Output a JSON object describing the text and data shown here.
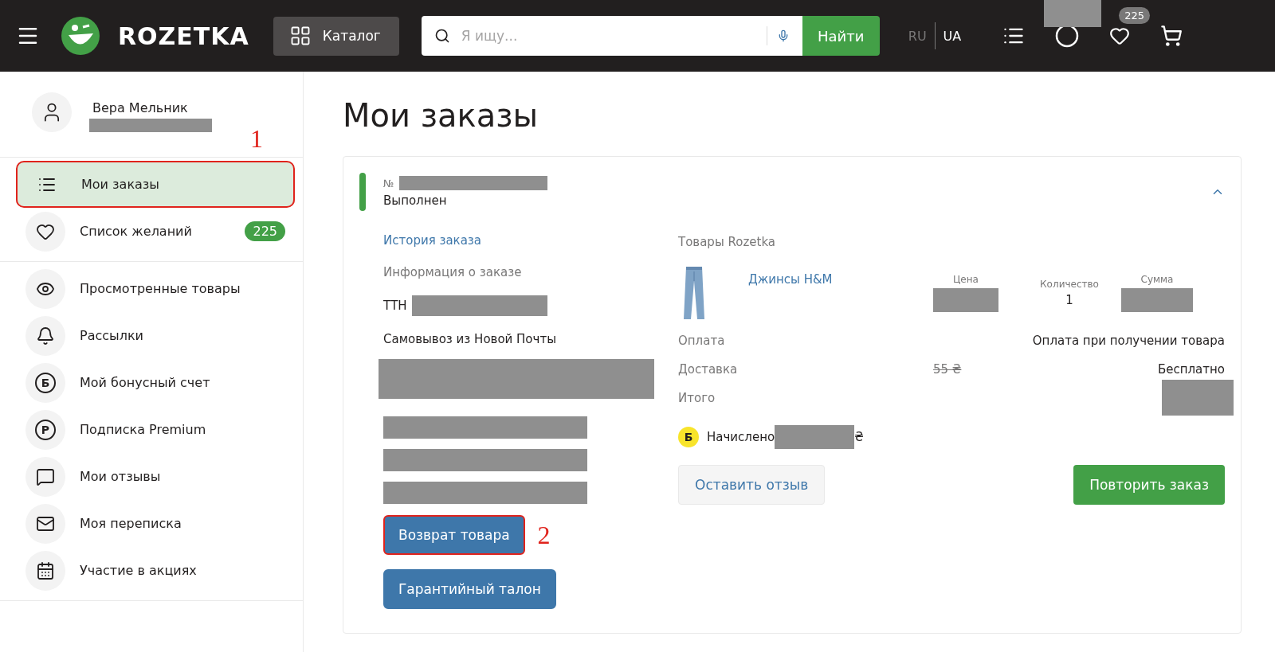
{
  "header": {
    "logo": "ROZETKA",
    "catalog_button": "Каталог",
    "search": {
      "placeholder": "Я ищу..."
    },
    "search_button": "Найти",
    "languages": [
      {
        "label": "RU",
        "selected": false
      },
      {
        "label": "UA",
        "selected": true
      }
    ],
    "wishlist_count": "225"
  },
  "sidebar": {
    "user": {
      "name": "Вера Мельник"
    },
    "annotation": "1",
    "groups": [
      [
        {
          "kind": "orders",
          "label": "Мои заказы",
          "selected": true,
          "highlighted": true
        },
        {
          "kind": "heart",
          "label": "Список желаний",
          "selected": false,
          "highlighted": false,
          "badge": "225"
        }
      ],
      [
        {
          "kind": "eye",
          "label": "Просмотренные товары",
          "selected": false,
          "highlighted": false
        },
        {
          "kind": "bell",
          "label": "Рассылки",
          "selected": false,
          "highlighted": false
        },
        {
          "kind": "glyph",
          "glyph": "Б",
          "label": "Мой бонусный счет",
          "selected": false,
          "highlighted": false
        },
        {
          "kind": "glyph",
          "glyph": "Р",
          "label": "Подписка Premium",
          "selected": false,
          "highlighted": false
        },
        {
          "kind": "message",
          "label": "Мои отзывы",
          "selected": false,
          "highlighted": false
        },
        {
          "kind": "mail",
          "label": "Моя переписка",
          "selected": false,
          "highlighted": false
        },
        {
          "kind": "calendar",
          "label": "Участие в акциях",
          "selected": false,
          "highlighted": false
        }
      ]
    ]
  },
  "page_title": "Мои заказы",
  "order": {
    "number_prefix": "№",
    "status": "Выполнен",
    "expanded": true,
    "history_link": "История заказа",
    "info_heading": "Информация о заказе",
    "ttn_label": "ТТН",
    "delivery_method": "Самовывоз из Новой Почты",
    "left_buttons": [
      {
        "label": "Возврат товара",
        "highlighted": true
      },
      {
        "label": "Гарантийный талон",
        "highlighted": false
      }
    ],
    "annotation": "2",
    "seller": "Товары Rozetka",
    "product": {
      "kind": "picture",
      "name": "Джинсы H&M",
      "price_label": "Цена",
      "quantity_label": "Количество",
      "quantity": "1",
      "sum_label": "Сумма"
    },
    "payment_label": "Оплата",
    "payment_value": "Оплата при получении товара",
    "delivery_label": "Доставка",
    "delivery_old_price": "55 ₴",
    "delivery_value": "Бесплатно",
    "total_label": "Итого",
    "bonus_glyph": "Б",
    "bonus_label": "Начислено",
    "bonus_currency": "₴",
    "right_buttons": [
      {
        "kind": "secondary",
        "label": "Оставить отзыв"
      },
      {
        "kind": "primary",
        "label": "Повторить заказ"
      }
    ]
  }
}
